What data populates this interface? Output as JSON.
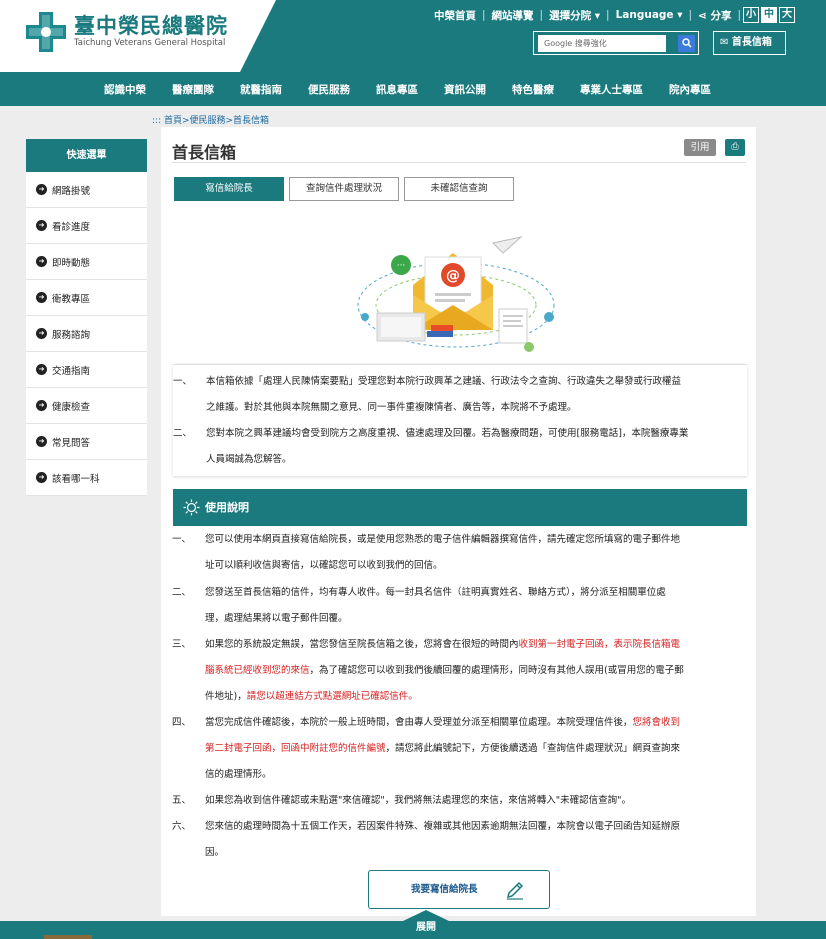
{
  "header": {
    "logo_zh": "臺中榮民總醫院",
    "logo_en": "Taichung Veterans General Hospital",
    "top_links": [
      "中榮首頁",
      "網站導覽",
      "選擇分院",
      "Language",
      "分享"
    ],
    "font_sizes": [
      "小",
      "中",
      "大"
    ],
    "search_placeholder": "Google 搜尋強化",
    "mailbox_label": "首長信箱",
    "colors": {
      "brand": "#1a7a7e",
      "search_button": "#3a7ad9"
    }
  },
  "nav": {
    "items": [
      "認識中榮",
      "醫療團隊",
      "就醫指南",
      "便民服務",
      "訊息專區",
      "資訊公開",
      "特色醫療",
      "專業人士專區",
      "院內專區"
    ]
  },
  "breadcrumb": ":::  首頁>便民服務>首長信箱",
  "sidebar": {
    "title": "快速選單",
    "items": [
      "網路掛號",
      "看診進度",
      "即時動態",
      "衛教專區",
      "服務諮詢",
      "交通指南",
      "健康檢查",
      "常見問答",
      "該看哪一科"
    ]
  },
  "main": {
    "title": "首長信箱",
    "cite_label": "引用",
    "tabs": [
      "寫信給院長",
      "查詢信件處理狀況",
      "未確認信查詢"
    ],
    "notice": [
      {
        "num": "一、",
        "line1": "本信箱依據「處理人民陳情案要點」受理您對本院行政興革之建議、行政法令之查詢、行政違失之舉發或行政權益",
        "line2": "之維護。對於其他與本院無關之意見、同一事件重複陳情者、廣告等，本院將不予處理。"
      },
      {
        "num": "二、",
        "line1": "您對本院之興革建議均會受到院方之高度重視、儘速處理及回覆。若為醫療問題，可使用[服務電話]，本院醫療專業",
        "line2": "人員竭誠為您解答。"
      }
    ],
    "usage_title": "使用說明",
    "usage": [
      {
        "num": "一、",
        "line1": "您可以使用本網頁直接寫信給院長，或是使用您熟悉的電子信件編輯器撰寫信件，請先確定您所填寫的電子郵件地",
        "line2": "址可以順利收信與寄信，以確認您可以收到我們的回信。"
      },
      {
        "num": "二、",
        "line1": "您發送至首長信箱的信件，均有專人收件。每一封具名信件（註明真實姓名、聯絡方式），將分派至相關單位處",
        "line2": "理，處理結果將以電子郵件回覆。"
      },
      {
        "num": "三、",
        "line1a": "如果您的系統設定無誤，當您發信至院長信箱之後，您將會在很短的時間內",
        "line1b": "收到第一封電子回函，表示院長信箱電",
        "line2a": "腦系統已經收到您的來信",
        "line2b": "，為了確認您可以收到我們後續回覆的處理情形，同時沒有其他人誤用(或冒用您的電子郵",
        "line3a": "件地址)，",
        "line3b": "請您以超連結方式點選網址已確認信件。"
      },
      {
        "num": "四、",
        "line1a": "當您完成信件確認後，本院於一般上班時間，會由專人受理並分派至相關單位處理。本院受理信件後，",
        "line1b": "您將會收到",
        "line2a": "第二封電子回函，回函中附註您的信件編號",
        "line2b": "，請您將此編號記下，方便後續透過「查詢信件處理狀況」網頁查詢來",
        "line3": "信的處理情形。"
      },
      {
        "num": "五、",
        "line1": "如果您為收到信件確認或未點選\"來信確認\"，我們將無法處理您的來信，來信將轉入\"未確認信查詢\"。"
      },
      {
        "num": "六、",
        "line1": "您來信的處理時間為十五個工作天，若因案件特殊、複雜或其他因素逾期無法回覆，本院會以電子回函告知延辦原",
        "line2": "因。"
      }
    ],
    "write_button": "我要寫信給院長"
  },
  "footer": {
    "expand_label": "展開"
  }
}
